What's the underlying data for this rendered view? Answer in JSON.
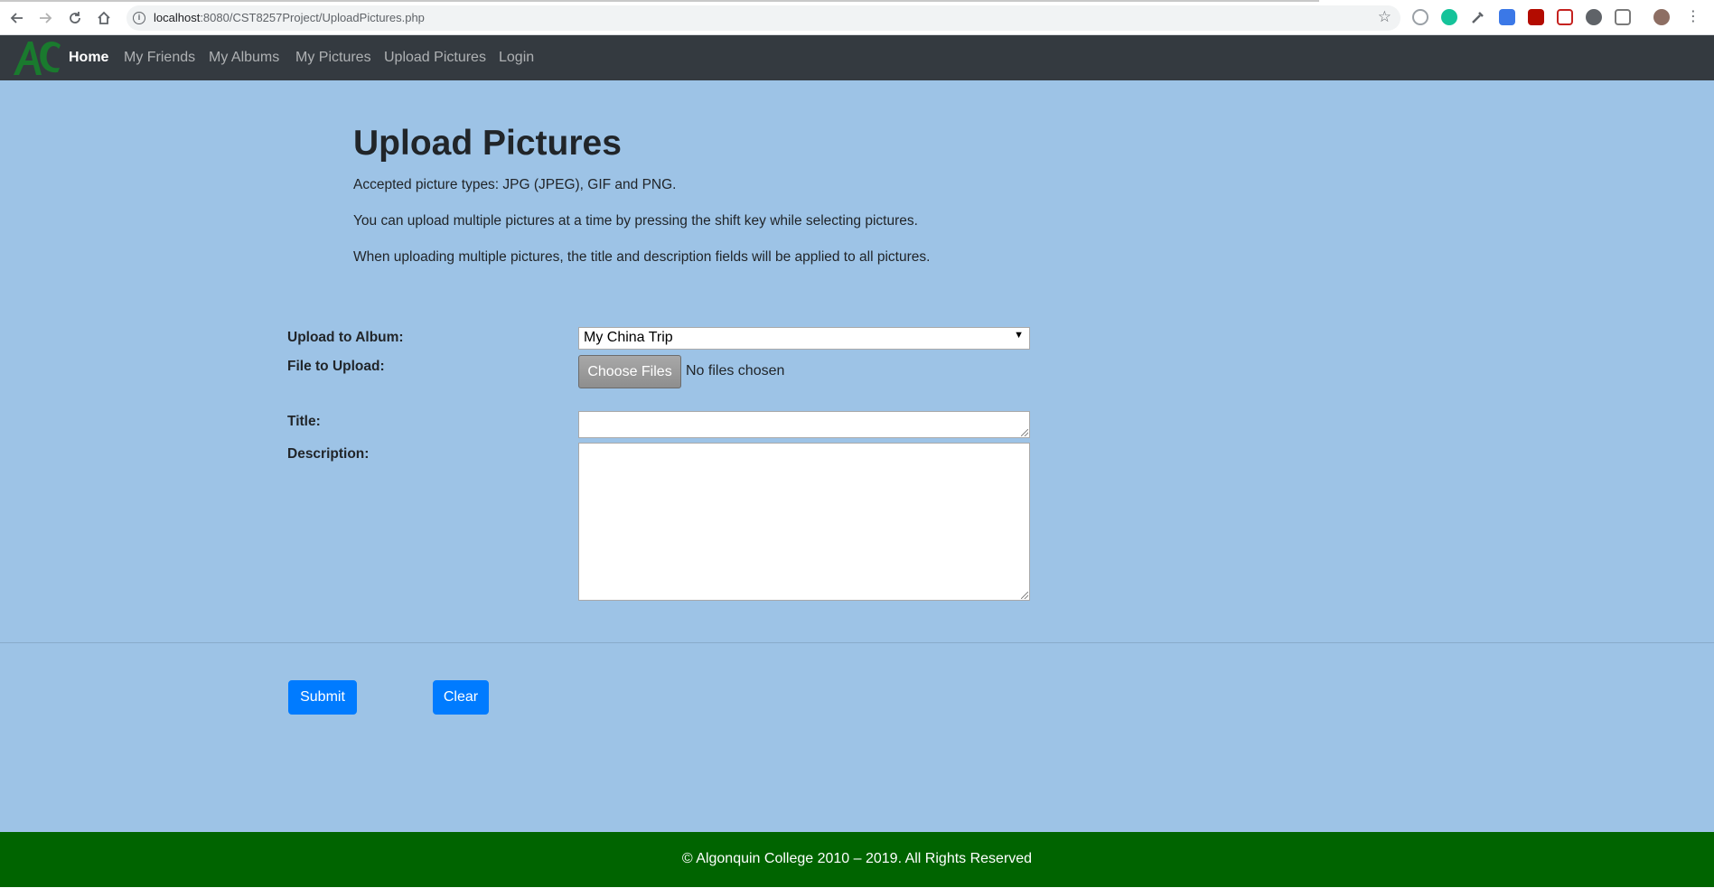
{
  "browser": {
    "url_host": "localhost",
    "url_path": ":8080/CST8257Project/UploadPictures.php",
    "icons": [
      "back-icon",
      "forward-icon",
      "reload-icon",
      "home-icon",
      "info-icon",
      "star-icon",
      "extensions",
      "profile-avatar",
      "menu-icon"
    ]
  },
  "navbar": {
    "brand": "AC",
    "links": [
      {
        "label": "Home",
        "active": true
      },
      {
        "label": "My Friends"
      },
      {
        "label": "My Albums"
      },
      {
        "label": "My Pictures"
      },
      {
        "label": "Upload Pictures"
      },
      {
        "label": "Login"
      }
    ]
  },
  "main": {
    "title": "Upload Pictures",
    "intro": [
      "Accepted picture types: JPG (JPEG), GIF and PNG.",
      "You can upload multiple pictures at a time by pressing the shift key while selecting pictures.",
      "When uploading multiple pictures, the title and description fields will be applied to all pictures."
    ],
    "form": {
      "album_label": "Upload to Album:",
      "album_value": "My China Trip",
      "file_label": "File to Upload:",
      "choose_files_label": "Choose Files",
      "no_files_text": "No files chosen",
      "title_label": "Title:",
      "title_value": "",
      "description_label": "Description:",
      "description_value": ""
    },
    "submit_label": "Submit",
    "clear_label": "Clear"
  },
  "footer": {
    "text": "© Algonquin College 2010 – 2019. All Rights Reserved"
  },
  "colors": {
    "navbar_bg": "#343a40",
    "main_bg": "#9dc3e6",
    "primary": "#007bff",
    "footer_bg": "#006400",
    "brand_green": "#1a7a2e"
  }
}
